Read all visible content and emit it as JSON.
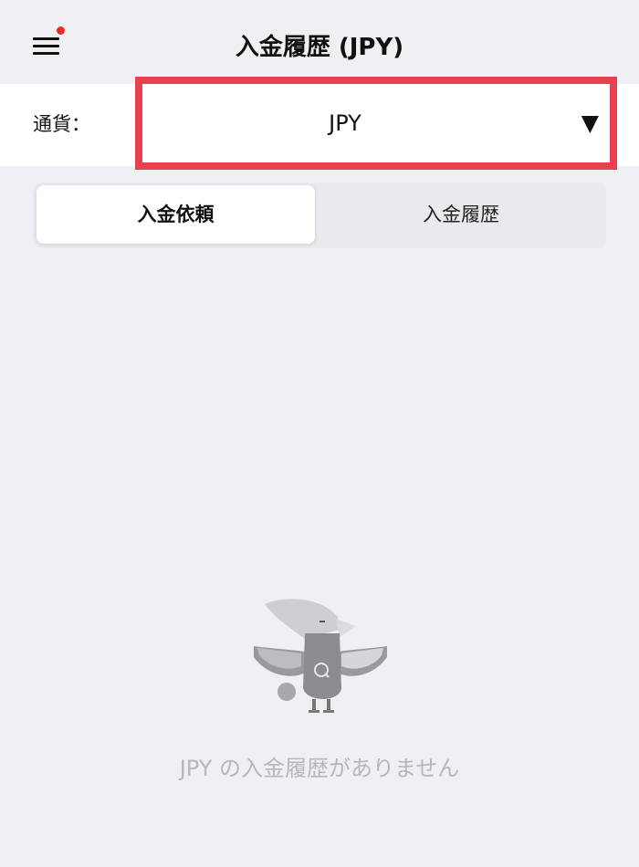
{
  "header": {
    "title": "入金履歴 (JPY)",
    "menu_icon": "hamburger-menu-icon",
    "notification_dot_color": "#e52d27"
  },
  "currency": {
    "label": "通貨：",
    "selected": "JPY",
    "dropdown_icon": "caret-down-icon",
    "highlight_color": "#e8414f"
  },
  "tabs": [
    {
      "label": "入金依頼",
      "active": true
    },
    {
      "label": "入金履歴",
      "active": false
    }
  ],
  "empty_state": {
    "illustration": "bird-mascot-illustration",
    "message": "JPY の入金履歴がありません"
  }
}
